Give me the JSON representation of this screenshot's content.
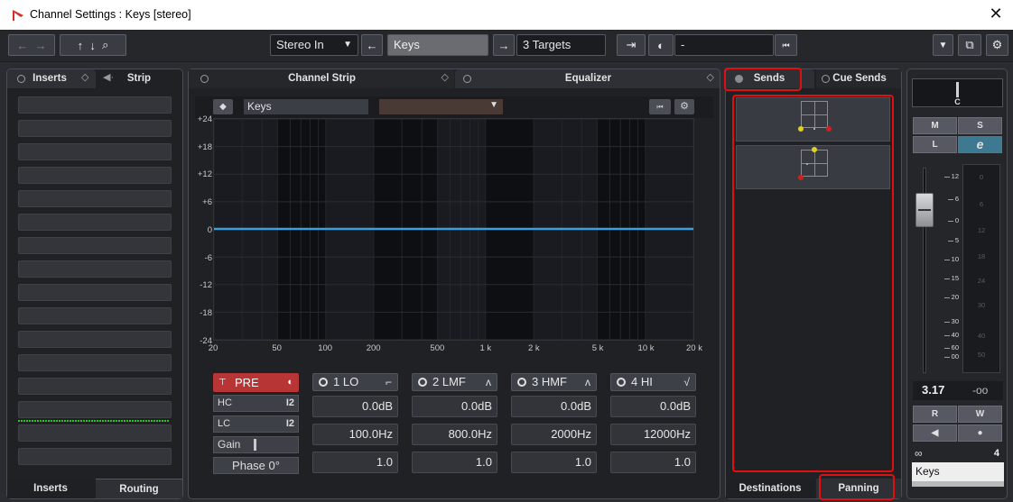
{
  "window": {
    "title": "Channel Settings : Keys [stereo]",
    "close_label": "✕"
  },
  "toolbar": {
    "input_routing": "Stereo In",
    "channel_name": "Keys",
    "targets": "3 Targets",
    "preset": "-"
  },
  "tabs": {
    "inserts": "Inserts",
    "strip": "Strip",
    "channel_strip": "Channel Strip",
    "equalizer": "Equalizer",
    "sends": "Sends",
    "cue_sends": "Cue Sends",
    "bottom_inserts": "Inserts",
    "bottom_routing": "Routing",
    "destinations": "Destinations",
    "panning": "Panning"
  },
  "eq": {
    "preset_name": "Keys",
    "y_labels": [
      "+24",
      "+18",
      "+12",
      "+6",
      "0",
      "-6",
      "-12",
      "-18",
      "-24"
    ],
    "x_labels": [
      "20",
      "50",
      "100",
      "200",
      "500",
      "1 k",
      "2 k",
      "5 k",
      "10 k",
      "20 k"
    ],
    "pre": {
      "label": "PRE",
      "hc": "HC",
      "lc": "LC",
      "gain": "Gain",
      "phase": "Phase 0°"
    },
    "bands": [
      {
        "name": "1 LO",
        "gain": "0.0dB",
        "freq": "100.0Hz",
        "q": "1.0"
      },
      {
        "name": "2 LMF",
        "gain": "0.0dB",
        "freq": "800.0Hz",
        "q": "1.0"
      },
      {
        "name": "3 HMF",
        "gain": "0.0dB",
        "freq": "2000Hz",
        "q": "1.0"
      },
      {
        "name": "4 HI",
        "gain": "0.0dB",
        "freq": "12000Hz",
        "q": "1.0"
      }
    ]
  },
  "fader": {
    "pan": "C",
    "mute": "M",
    "solo": "S",
    "listen": "L",
    "edit": "e",
    "scale": [
      "12",
      "6",
      "0",
      "5",
      "10",
      "15",
      "20",
      "30",
      "40",
      "60",
      "00"
    ],
    "meter_scale": [
      "0",
      "6",
      "12",
      "18",
      "24",
      "30",
      "40",
      "50"
    ],
    "volume": "3.17",
    "peak": "-oo",
    "read": "R",
    "write": "W",
    "group_count": "4",
    "channel_name": "Keys"
  },
  "colors": {
    "accent_red": "#e01010",
    "eq_curve": "#3aa0e0",
    "pan_yellow": "#e0d020",
    "pan_red": "#d02020"
  }
}
